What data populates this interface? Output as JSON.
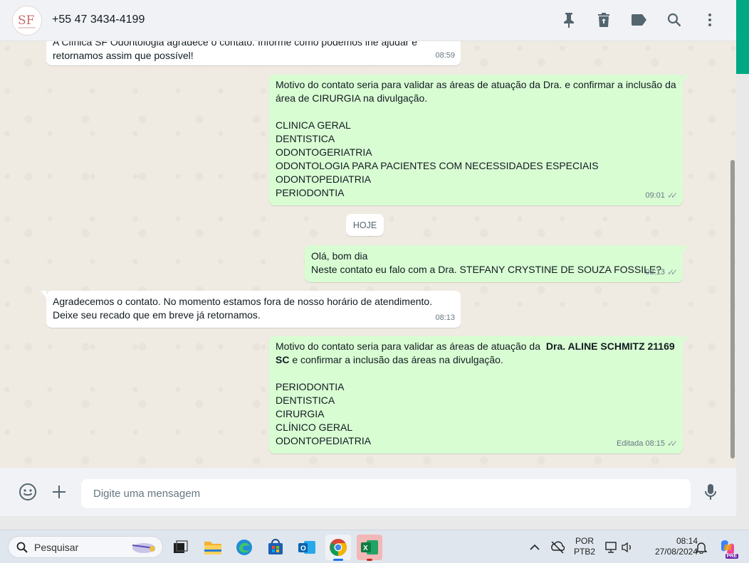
{
  "header": {
    "contact_name": "+55 47 3434-4199",
    "avatar_text": "SF",
    "icons": [
      "pin-icon",
      "trash-icon",
      "label-icon",
      "search-icon",
      "more-vertical-icon"
    ]
  },
  "messages": [
    {
      "dir": "in",
      "lines": [
        "A Clínica SF Odontologia agradece o contato. Informe como podemos lhe ajudar e",
        "retornamos assim que possível!"
      ],
      "time": "08:59"
    },
    {
      "dir": "out",
      "lines": [
        "Motivo do contato seria para validar as áreas de atuação da Dra. e confirmar a inclusão da",
        "área de CIRURGIA na divulgação.",
        "",
        "CLINICA GERAL",
        "DENTISTICA",
        "ODONTOGERIATRIA",
        "ODONTOLOGIA PARA PACIENTES COM NECESSIDADES ESPECIAIS",
        "ODONTOPEDIATRIA",
        "PERIODONTIA"
      ],
      "time": "09:01"
    },
    {
      "dir": "out",
      "lines": [
        "Olá, bom dia",
        "Neste contato eu falo com a Dra. STEFANY CRYSTINE DE SOUZA FOSSILE?"
      ],
      "time": "08:13"
    },
    {
      "dir": "in",
      "lines": [
        "Agradecemos o contato. No momento estamos fora de nosso horário de atendimento.",
        "Deixe seu recado que em breve já retornamos."
      ],
      "time": "08:13"
    },
    {
      "dir": "out",
      "lines_rich": {
        "l1_pre": "Motivo do contato seria para validar as áreas de atuação da ",
        "l1_bold": "Dra. ALINE SCHMITZ 21169",
        "l2_bold": "SC",
        "l2_post": " e confirmar a inclusão das áreas na divulgação."
      },
      "lines": [
        "",
        "PERIODONTIA",
        "DENTISTICA",
        "CIRURGIA",
        "CLÍNICO GERAL",
        "ODONTOPEDIATRIA"
      ],
      "edited": "Editada",
      "time": "08:15"
    }
  ],
  "day_separator": "HOJE",
  "compose": {
    "placeholder": "Digite uma mensagem",
    "icons": [
      "emoji-icon",
      "plus-icon",
      "microphone-icon"
    ]
  },
  "taskbar": {
    "search_label": "Pesquisar",
    "apps": [
      "task-view",
      "file-explorer",
      "edge",
      "microsoft-store",
      "outlook",
      "chrome",
      "excel"
    ],
    "lang_line1": "POR",
    "lang_line2": "PTB2",
    "time": "08:14",
    "date": "27/08/2024",
    "copilot_badge": "PRE"
  },
  "colors": {
    "outgoing": "#d9fdd3",
    "incoming": "#ffffff",
    "accent": "#00a884"
  }
}
